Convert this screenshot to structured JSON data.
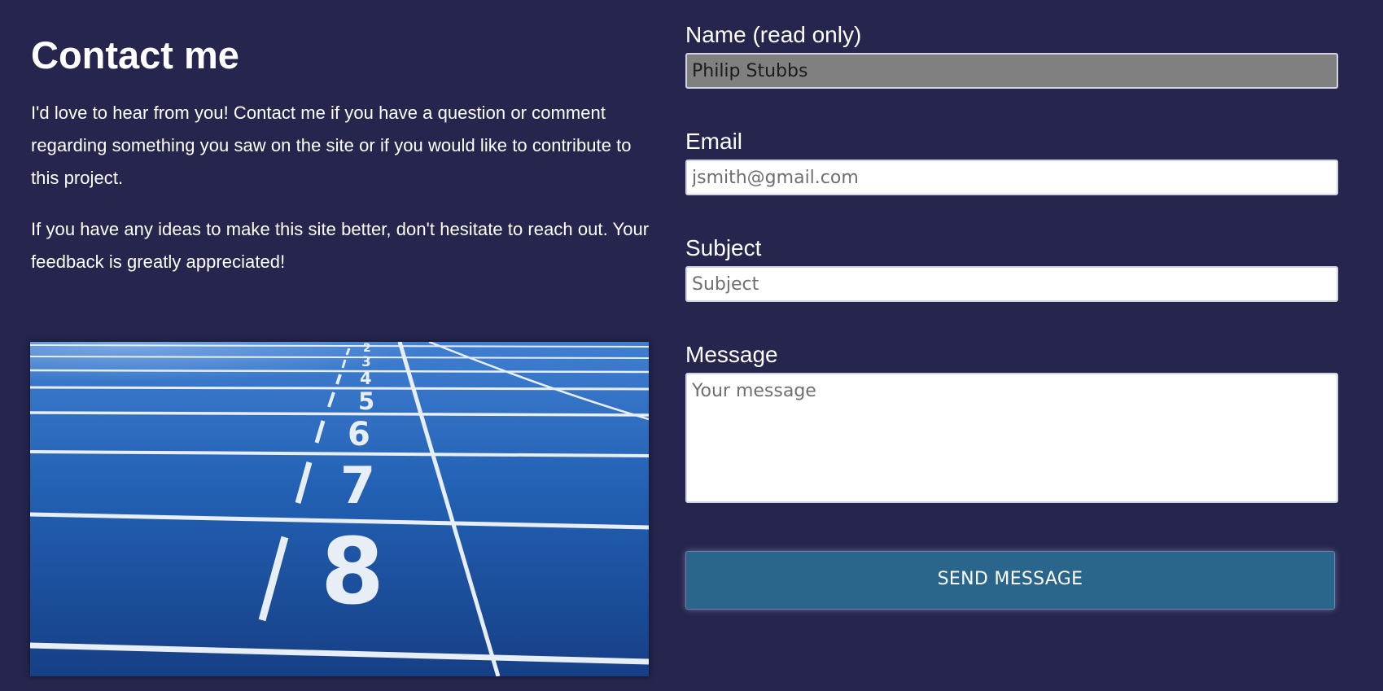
{
  "intro": {
    "title": "Contact me",
    "paragraph_1": "I'd love to hear from you! Contact me if you have a question or comment regarding something you saw on the site or if you would like to contribute to this project.",
    "paragraph_2": "If you have any ideas to make this site better, don't hesitate to reach out. Your feedback is greatly appreciated!"
  },
  "photo": {
    "lane_numbers": [
      "2",
      "3",
      "4",
      "5",
      "6",
      "7",
      "8"
    ]
  },
  "form": {
    "name": {
      "label": "Name (read only)",
      "value": "Philip Stubbs"
    },
    "email": {
      "label": "Email",
      "placeholder": "jsmith@gmail.com"
    },
    "subject": {
      "label": "Subject",
      "placeholder": "Subject"
    },
    "message": {
      "label": "Message",
      "placeholder": "Your message"
    },
    "submit_label": "SEND MESSAGE"
  },
  "colors": {
    "background": "#25254d",
    "button": "#2a668b",
    "readonly_field": "#808080",
    "track": "#1f5aa8"
  }
}
